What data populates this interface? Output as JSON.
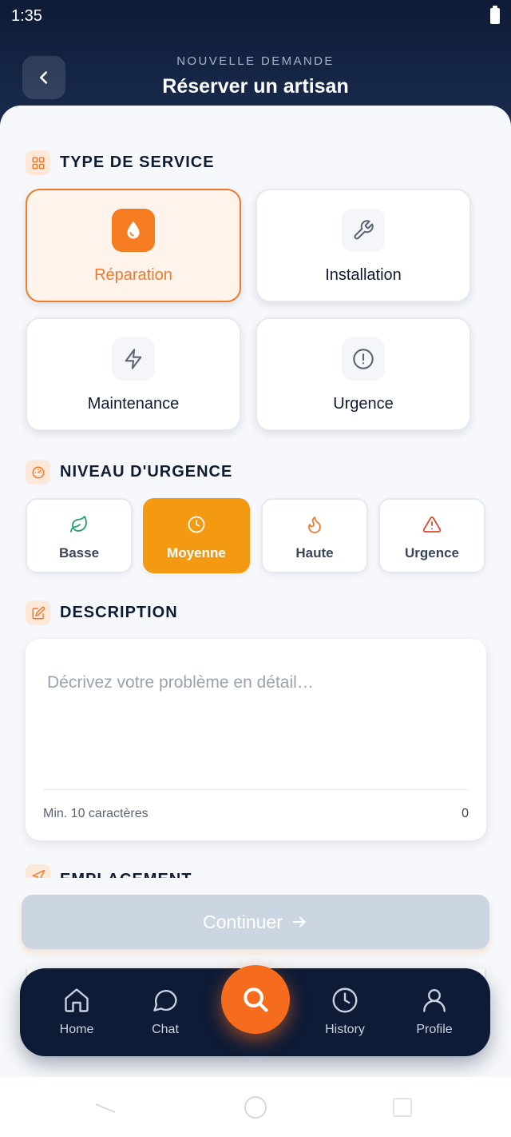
{
  "status": {
    "time": "1:35"
  },
  "header": {
    "overline": "NOUVELLE DEMANDE",
    "title": "Réserver un artisan"
  },
  "service_section": {
    "title": "TYPE DE SERVICE",
    "options": [
      {
        "label": "Réparation",
        "icon": "water-drop-icon",
        "selected": true
      },
      {
        "label": "Installation",
        "icon": "wrench-icon",
        "selected": false
      },
      {
        "label": "Maintenance",
        "icon": "lightning-icon",
        "selected": false
      },
      {
        "label": "Urgence",
        "icon": "alert-circle-icon",
        "selected": false
      }
    ]
  },
  "urgency_section": {
    "title": "NIVEAU D'URGENCE",
    "options": [
      {
        "label": "Basse",
        "icon": "leaf-icon",
        "selected": false
      },
      {
        "label": "Moyenne",
        "icon": "clock-icon",
        "selected": true
      },
      {
        "label": "Haute",
        "icon": "flame-icon",
        "selected": false
      },
      {
        "label": "Urgence",
        "icon": "warning-triangle-icon",
        "selected": false
      }
    ]
  },
  "description_section": {
    "title": "DESCRIPTION",
    "placeholder": "Décrivez votre problème en détail…",
    "hint": "Min. 10 caractères",
    "count": "0"
  },
  "location_section": {
    "title": "EMPLACEMENT"
  },
  "continue_button": {
    "label": "Continuer"
  },
  "bottom_nav": {
    "items": [
      {
        "label": "Home",
        "icon": "home-icon"
      },
      {
        "label": "Chat",
        "icon": "chat-icon"
      },
      {
        "label": "History",
        "icon": "history-icon"
      },
      {
        "label": "Profile",
        "icon": "profile-icon"
      }
    ],
    "fab_icon": "search-icon"
  },
  "colors": {
    "header_bg": "#0e1b36",
    "accent_orange": "#f07a2a",
    "urgency_selected": "#f39a12",
    "disabled_button": "#ccd6e2",
    "nav_bg": "#0e1b36"
  }
}
